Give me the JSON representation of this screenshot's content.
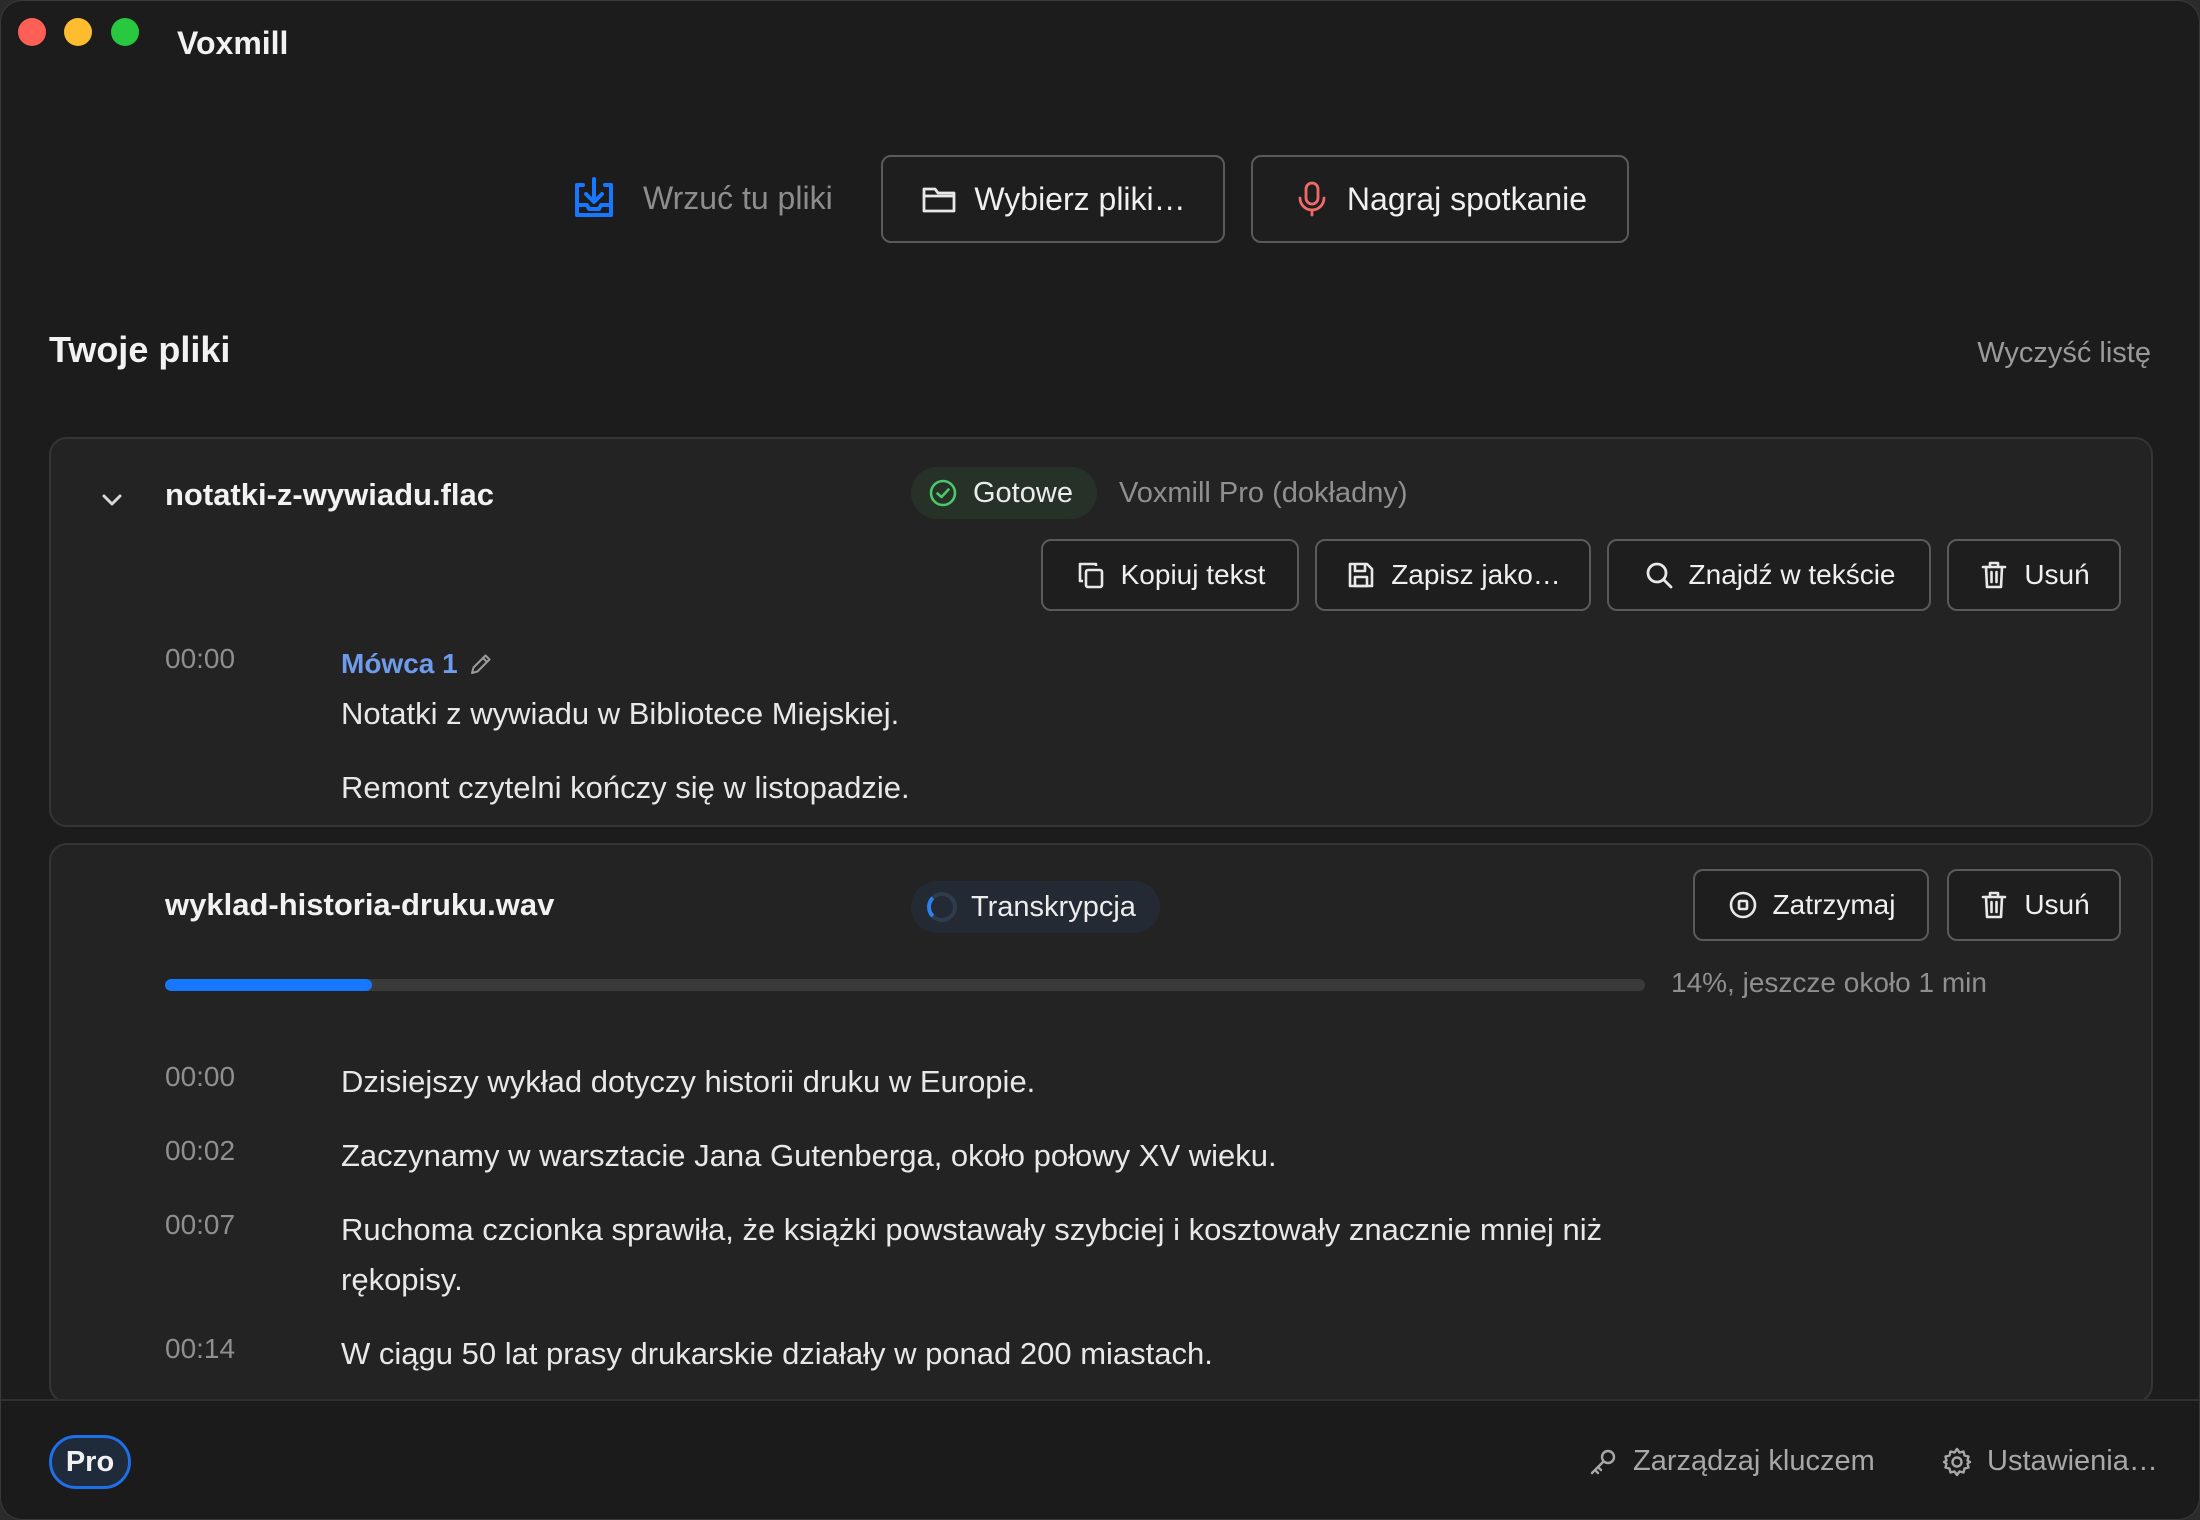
{
  "window": {
    "title": "Voxmill"
  },
  "import": {
    "drop_label": "Wrzuć tu pliki",
    "choose_files": "Wybierz pliki…",
    "record_meeting": "Nagraj spotkanie"
  },
  "files_section": {
    "title": "Twoje pliki",
    "clear_list": "Wyczyść listę"
  },
  "files": [
    {
      "name": "notatki-z-wywiadu.flac",
      "status": "Gotowe",
      "model": "Voxmill Pro (dokładny)",
      "actions": {
        "copy": "Kopiuj tekst",
        "save_as": "Zapisz jako…",
        "find": "Znajdź w tekście",
        "delete": "Usuń"
      },
      "speaker": "Mówca 1",
      "segments": [
        {
          "time": "00:00",
          "lines": [
            "Notatki z wywiadu w Bibliotece Miejskiej.",
            "Remont czytelni kończy się w listopadzie."
          ]
        }
      ]
    },
    {
      "name": "wyklad-historia-druku.wav",
      "status": "Transkrypcja",
      "actions": {
        "stop": "Zatrzymaj",
        "delete": "Usuń"
      },
      "progress": {
        "percent": 14,
        "label": "14%, jeszcze około 1 min"
      },
      "segments": [
        {
          "time": "00:00",
          "text": "Dzisiejszy wykład dotyczy historii druku w Europie."
        },
        {
          "time": "00:02",
          "text": "Zaczynamy w warsztacie Jana Gutenberga, około połowy XV wieku."
        },
        {
          "time": "00:07",
          "text": "Ruchoma czcionka sprawiła, że książki powstawały szybciej i kosztowały znacznie mniej niż rękopisy."
        },
        {
          "time": "00:14",
          "text": "W ciągu 50 lat prasy drukarskie działały w ponad 200 miastach."
        }
      ]
    }
  ],
  "footer": {
    "plan": "Pro",
    "manage_key": "Zarządzaj kluczem",
    "settings": "Ustawienia…"
  },
  "colors": {
    "accent": "#1677ff",
    "speaker": "#6e9bea",
    "success": "#4cc76a",
    "record": "#f06a6a"
  },
  "icons": [
    "download-tray-icon",
    "folder-icon",
    "microphone-icon",
    "chevron-down-icon",
    "check-circle-icon",
    "copy-icon",
    "save-icon",
    "search-icon",
    "trash-icon",
    "pencil-icon",
    "stop-icon",
    "spinner-icon",
    "key-icon",
    "gear-icon"
  ]
}
